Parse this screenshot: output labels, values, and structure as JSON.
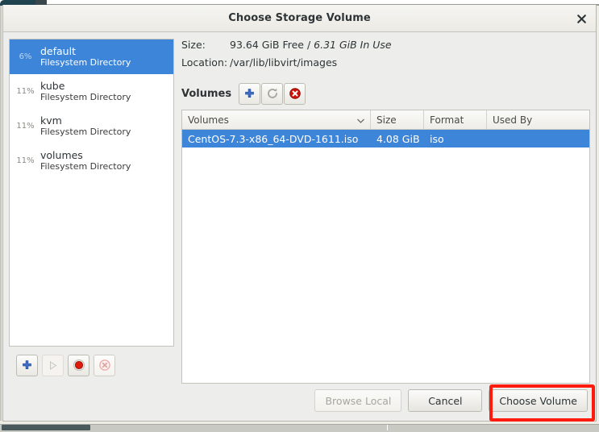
{
  "window": {
    "title": "Choose Storage Volume",
    "close_icon": "close-icon"
  },
  "pools": {
    "items": [
      {
        "percent": "6%",
        "name": "default",
        "type": "Filesystem Directory",
        "selected": true
      },
      {
        "percent": "11%",
        "name": "kube",
        "type": "Filesystem Directory",
        "selected": false
      },
      {
        "percent": "11%",
        "name": "kvm",
        "type": "Filesystem Directory",
        "selected": false
      },
      {
        "percent": "11%",
        "name": "volumes",
        "type": "Filesystem Directory",
        "selected": false
      }
    ],
    "toolbar": [
      {
        "name": "add-pool-button",
        "icon": "plus-icon",
        "enabled": true
      },
      {
        "name": "start-pool-button",
        "icon": "play-icon",
        "enabled": false
      },
      {
        "name": "stop-pool-button",
        "icon": "stop-circle-icon",
        "enabled": true
      },
      {
        "name": "delete-pool-button",
        "icon": "delete-x-icon",
        "enabled": false
      }
    ]
  },
  "details": {
    "size_label": "Size:",
    "size_value_plain": "93.64 GiB Free / ",
    "size_value_em": "6.31 GiB In Use",
    "location_label": "Location:",
    "location_value": "/var/lib/libvirt/images"
  },
  "volumes_section": {
    "label": "Volumes",
    "toolbar": [
      {
        "name": "add-volume-button",
        "icon": "plus-icon",
        "enabled": true
      },
      {
        "name": "refresh-volumes-button",
        "icon": "refresh-icon",
        "enabled": false
      },
      {
        "name": "delete-volume-button",
        "icon": "delete-circle-icon",
        "enabled": true
      }
    ],
    "columns": [
      {
        "label": "Volumes",
        "sorted": true
      },
      {
        "label": "Size",
        "sorted": false
      },
      {
        "label": "Format",
        "sorted": false
      },
      {
        "label": "Used By",
        "sorted": false
      }
    ],
    "rows": [
      {
        "volume": "CentOS-7.3-x86_64-DVD-1611.iso",
        "size": "4.08 GiB",
        "format": "iso",
        "used_by": "",
        "selected": true
      }
    ]
  },
  "footer": {
    "browse_local_label": "Browse Local",
    "browse_local_enabled": false,
    "cancel_label": "Cancel",
    "choose_volume_label": "Choose Volume"
  },
  "colors": {
    "selection_blue": "#3d85d8",
    "annotation_red": "#ff1b0d",
    "dialog_bg": "#ededeb"
  }
}
